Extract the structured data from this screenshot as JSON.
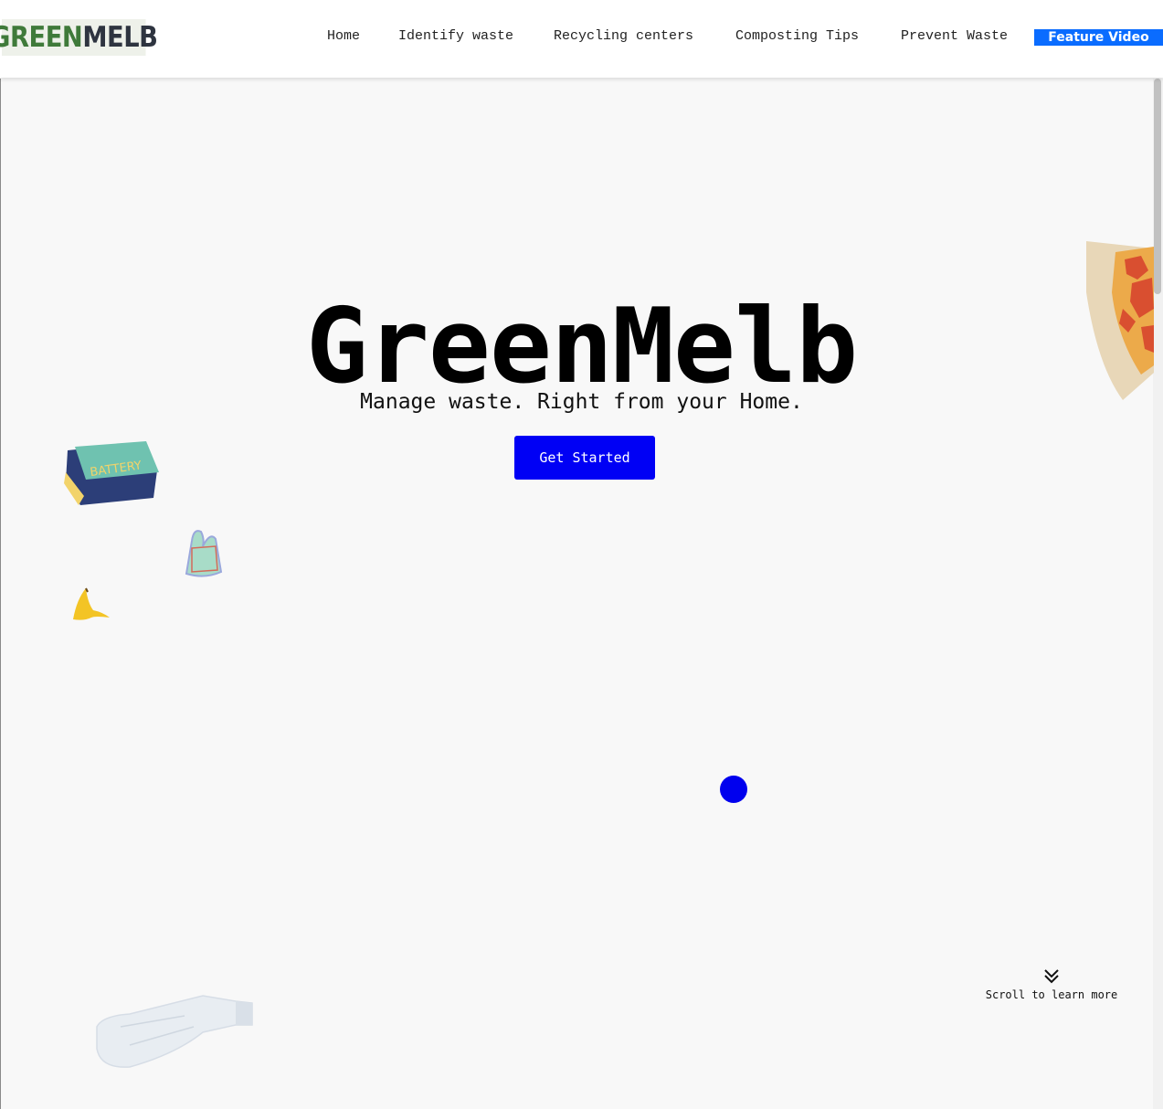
{
  "logo": {
    "part1": "GREEN",
    "part2": "MELB"
  },
  "nav": {
    "links": [
      "Home",
      "Identify waste",
      "Recycling centers",
      "Composting Tips",
      "Prevent Waste"
    ],
    "cta": "Feature Video"
  },
  "hero": {
    "title": "GreenMelb",
    "subtitle": "Manage waste. Right from your Home.",
    "button": "Get Started"
  },
  "decorations": {
    "battery_text": "BATTERY"
  },
  "scroll": {
    "label": "Scroll to learn more"
  },
  "colors": {
    "accent": "#0000f5",
    "nav_cta": "#0a6cff",
    "logo_green": "#3f7a3a",
    "logo_dark": "#2e3440"
  }
}
